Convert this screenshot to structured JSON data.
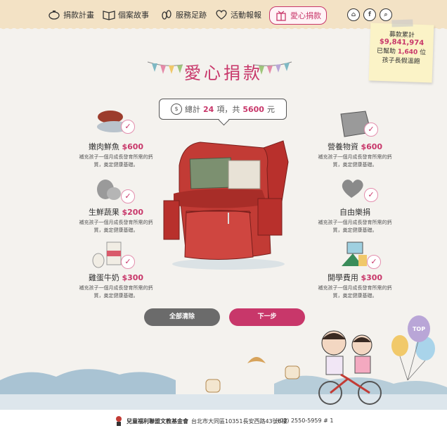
{
  "nav": {
    "items": [
      {
        "label": "捐款計畫",
        "icon": "piggy-bank-icon"
      },
      {
        "label": "個案故事",
        "icon": "book-icon"
      },
      {
        "label": "服務足跡",
        "icon": "footprint-icon"
      },
      {
        "label": "活動報報",
        "icon": "heart-icon"
      },
      {
        "label": "愛心捐款",
        "icon": "gift-icon",
        "active": true
      }
    ],
    "home_icon": "home-icon",
    "facebook_icon": "facebook-icon",
    "search_icon": "search-icon"
  },
  "sticky": {
    "line1": "募款累計",
    "amount": "$9,841,974",
    "line3_prefix": "已幫助",
    "line3_num": "1,640",
    "line3_suffix": "位",
    "line4": "孩子長假溫飽"
  },
  "page_title": "愛心捐款",
  "summary": {
    "coin_symbol": "$",
    "prefix": "總計",
    "count": "24",
    "count_unit": "項，共",
    "total": "5600",
    "total_unit": "元"
  },
  "items": [
    {
      "name": "嫩肉鮮魚",
      "price": "$600",
      "desc": "補充孩子一個月成長發育所需的鈣質，奠定健康基礎。"
    },
    {
      "name": "生鮮蔬果",
      "price": "$200",
      "desc": "補充孩子一個月成長發育所需的鈣質，奠定健康基礎。"
    },
    {
      "name": "雞蛋牛奶",
      "price": "$300",
      "desc": "補充孩子一個月成長發育所需的鈣質，奠定健康基礎。"
    },
    {
      "name": "營養物資",
      "price": "$600",
      "desc": "補充孩子一個月成長發育所需的鈣質，奠定健康基礎。"
    },
    {
      "name": "自由樂捐",
      "price": "",
      "desc": "補充孩子一個月成長發育所需的鈣質，奠定健康基礎。"
    },
    {
      "name": "開學費用",
      "price": "$300",
      "desc": "補充孩子一個月成長發育所需的鈣質，奠定健康基礎。"
    }
  ],
  "buttons": {
    "clear": "全部清除",
    "next": "下一步"
  },
  "top_button": "TOP",
  "footer": {
    "org": "兒童福利聯盟文教基金會",
    "address": "台北市大同區10351長安西路43號6樓",
    "phone": "(02) 2550-5959 # 1"
  },
  "colors": {
    "accent": "#c8376a",
    "topbar": "#f3e2c5",
    "sticky": "#fbf3c7",
    "bag": "#c23b35"
  }
}
